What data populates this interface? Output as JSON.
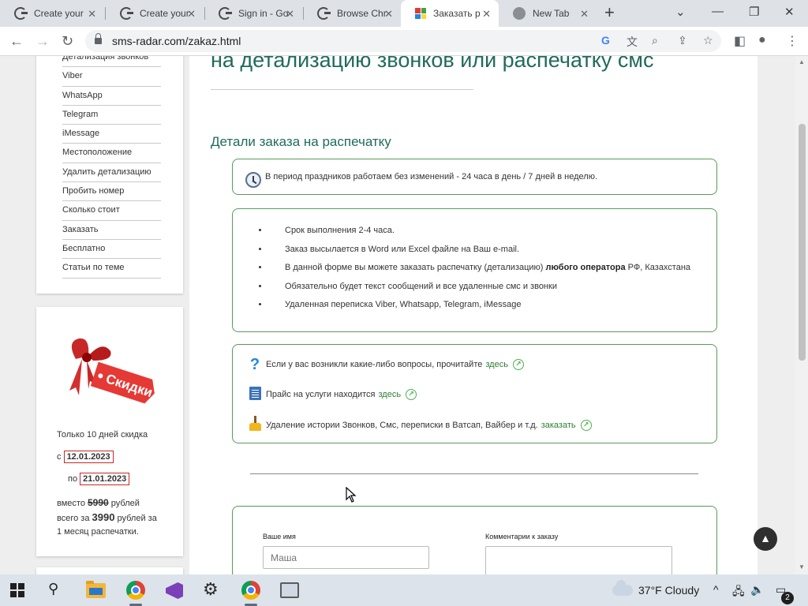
{
  "browser": {
    "tabs": [
      {
        "title": "Create your",
        "close": "✕"
      },
      {
        "title": "Create your",
        "close": "✕"
      },
      {
        "title": "Sign in - Go",
        "close": "✕"
      },
      {
        "title": "Browse Chr",
        "close": "✕"
      },
      {
        "title": "Заказать р",
        "close": "✕",
        "active": true
      },
      {
        "title": "New Tab",
        "close": "✕"
      }
    ],
    "new_tab": "+",
    "url": "sms-radar.com/zakaz.html"
  },
  "sidebar": {
    "items": [
      "Детализация звонков",
      "Viber",
      "WhatsApp",
      "Telegram",
      "iMessage",
      "Местоположение",
      "Удалить детализацию",
      "Пробить номер",
      "Сколько стоит",
      "Заказать",
      "Бесплатно",
      "Статьи по теме"
    ]
  },
  "promo": {
    "badge_text": "Скидки",
    "line1": "Только 10 дней скидка",
    "from_prefix": "с",
    "from_date": "12.01.2023",
    "to_prefix": "по",
    "to_date": "21.01.2023",
    "instead": "вместо",
    "old_price": "5990",
    "rub1": "рублей",
    "total_prefix": "всего за",
    "new_price": "3990",
    "rub2": "рублей за",
    "period": "1 месяц распечатки."
  },
  "main": {
    "heading": "на детализацию звонков или распечатку смс",
    "subheading": "Детали заказа на распечатку",
    "holiday_notice": "В период праздников работаем без изменений - 24 часа в день / 7 дней в неделю.",
    "info_items": [
      "Срок выполнения 2-4 часа.",
      "Заказ высылается в Word или Excel файле на Ваш e-mail.",
      "Обязательно будет текст сообщений и все удаленные смс и звонки",
      "Удаленная переписка Viber, Whatsapp, Telegram, iMessage"
    ],
    "info_operator_prefix": "В данной форме вы можете заказать распечатку (детализацию) ",
    "info_operator_bold": "любого оператора",
    "info_operator_suffix": " РФ, Казахстана",
    "links": [
      {
        "text": "Если у вас возникли какие-либо вопросы, прочитайте",
        "link": "здесь"
      },
      {
        "text": "Прайс на услуги находится",
        "link": "здесь"
      },
      {
        "text": "Удаление истории Звонков, Смс, переписки в Ватсап, Вайбер и т.д.",
        "link": "заказать"
      }
    ],
    "form": {
      "name_label": "Ваше имя",
      "name_placeholder": "Маша",
      "comment_label": "Комментарии к заказу"
    }
  },
  "taskbar": {
    "weather": "37°F  Cloudy",
    "notifications": "2"
  }
}
